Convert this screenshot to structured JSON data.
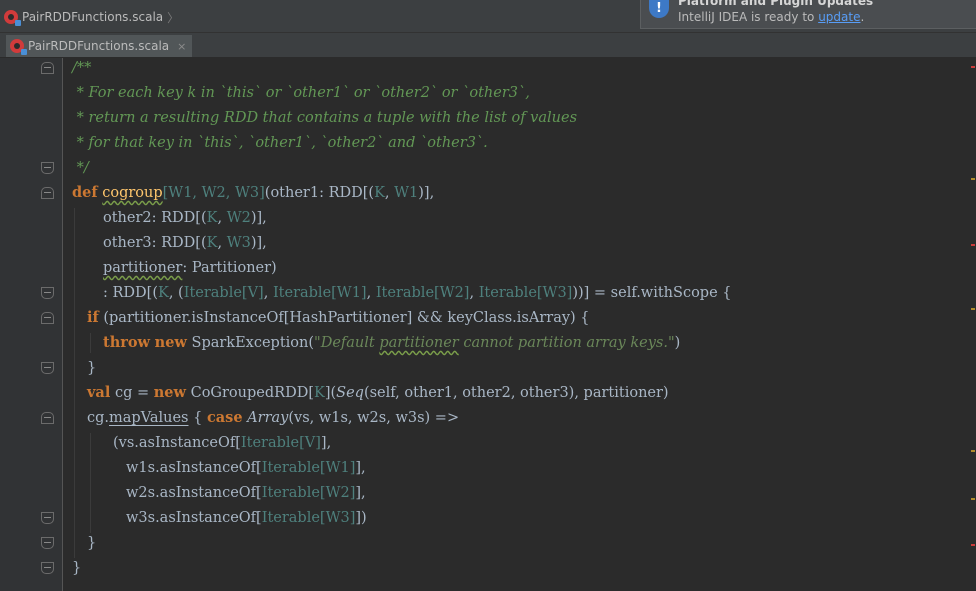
{
  "navbar": {
    "breadcrumb": "PairRDDFunctions.scala",
    "arrow": "〉"
  },
  "notification": {
    "title": "Platform and Plugin Updates",
    "text_prefix": "IntelliJ IDEA is ready to ",
    "link": "update",
    "text_suffix": "."
  },
  "tabs": [
    {
      "label": "PairRDDFunctions.scala",
      "close": "×"
    }
  ],
  "code": {
    "l01": "/**",
    "l02": " * For each key k in `this` or `other1` or `other2` or `other3`,",
    "l03": " * return a resulting RDD that contains a tuple with the list of values",
    "l04": " * for that key in `this`, `other1`, `other2` and `other3`.",
    "l05": " */",
    "l06_def": "def",
    "l06_fn": "cogroup",
    "l06_t1": "[W1, W2, W3]",
    "l06_a": "(other1: RDD[(",
    "l06_k": "K",
    "l06_b": ", ",
    "l06_w": "W1",
    "l06_c": ")],",
    "l07_a": "other2: RDD[(",
    "l07_k": "K",
    "l07_b": ", ",
    "l07_w": "W2",
    "l07_c": ")],",
    "l08_a": "other3: RDD[(",
    "l08_k": "K",
    "l08_b": ", ",
    "l08_w": "W3",
    "l08_c": ")],",
    "l09_a": "partitioner",
    "l09_b": ": Partitioner)",
    "l10_a": ": RDD[(",
    "l10_k": "K",
    "l10_b": ", (",
    "l10_t1": "Iterable[V]",
    "l10_c": ", ",
    "l10_t2": "Iterable[W1]",
    "l10_d": ", ",
    "l10_t3": "Iterable[W2]",
    "l10_e": ", ",
    "l10_t4": "Iterable[W3]",
    "l10_f": "))] = self.withScope {",
    "l11_kw": "if",
    "l11_a": " (partitioner.isInstanceOf[HashPartitioner] && keyClass.isArray) {",
    "l12_kw1": "throw",
    "l12_sp": " ",
    "l12_kw2": "new",
    "l12_a": " SparkException(",
    "l12_s1": "\"Default ",
    "l12_s2": "partitioner",
    "l12_s3": " cannot partition array keys.\"",
    "l12_b": ")",
    "l13": "}",
    "l14_kw1": "val",
    "l14_a": " cg = ",
    "l14_kw2": "new",
    "l14_b": " CoGroupedRDD[",
    "l14_k": "K",
    "l14_c": "](",
    "l14_seq": "Seq",
    "l14_d": "(self, other1, other2, other3), partitioner)",
    "l15_a": "cg.",
    "l15_mv": "mapValues",
    "l15_b": " { ",
    "l15_kw": "case",
    "l15_arr": " Array",
    "l15_c": "(vs, w1s, w2s, w3s) =>",
    "l16_a": "(vs.asInstanceOf[",
    "l16_t": "Iterable[V]",
    "l16_b": "],",
    "l17_a": "w1s.asInstanceOf[",
    "l17_t": "Iterable[W1]",
    "l17_b": "],",
    "l18_a": "w2s.asInstanceOf[",
    "l18_t": "Iterable[W2]",
    "l18_b": "],",
    "l19_a": "w3s.asInstanceOf[",
    "l19_t": "Iterable[W3]",
    "l19_b": "])",
    "l20": "}",
    "l21": "}"
  },
  "colors": {
    "comment": "#629755",
    "keyword": "#cc7832",
    "type_param": "#4e807d",
    "string": "#6a8759",
    "background": "#2b2b2b"
  }
}
